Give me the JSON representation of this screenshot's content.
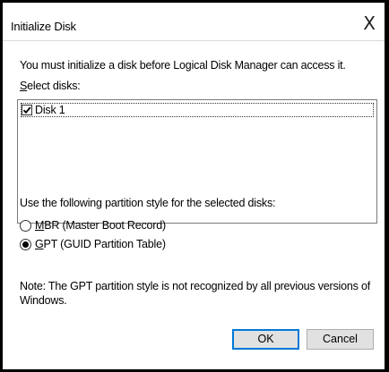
{
  "window": {
    "title": "Initialize Disk",
    "close_glyph": "X"
  },
  "instructions": "You must initialize a disk before Logical Disk Manager can access it.",
  "select_disks": {
    "label_prefix": "",
    "label_access_key": "S",
    "label_rest": "elect disks:",
    "items": [
      {
        "label": "Disk 1",
        "checked": true
      }
    ]
  },
  "partition_style": {
    "label": "Use the following partition style for the selected disks:",
    "options": [
      {
        "access_key": "M",
        "rest": "BR (Master Boot Record)",
        "selected": false
      },
      {
        "access_key": "G",
        "rest": "PT (GUID Partition Table)",
        "selected": true
      }
    ]
  },
  "note": "Note: The GPT partition style is not recognized by all previous versions of Windows.",
  "buttons": {
    "ok": "OK",
    "cancel": "Cancel"
  },
  "colors": {
    "focus_border": "#0078d7",
    "button_face": "#e1e1e1",
    "frame": "#000000"
  }
}
